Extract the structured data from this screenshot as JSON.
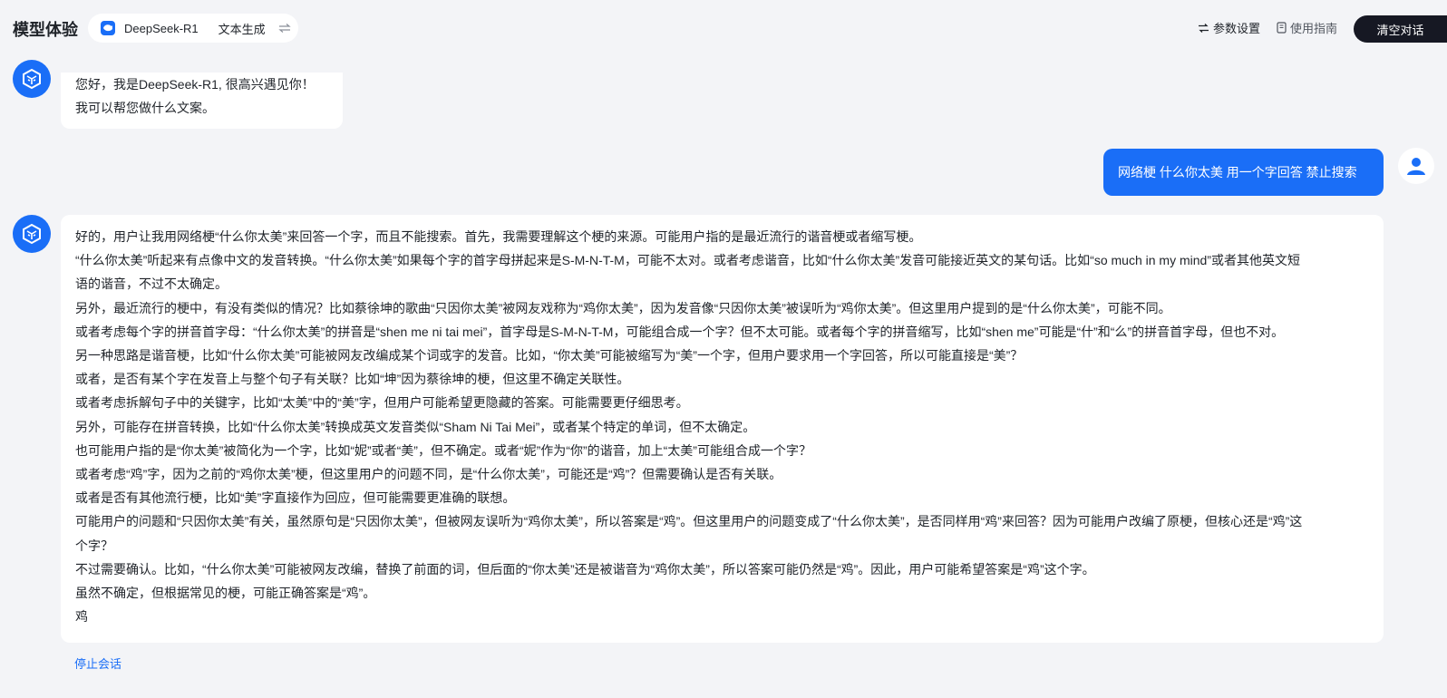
{
  "header": {
    "app_title": "模型体验",
    "model_name": "DeepSeek-R1",
    "model_mode": "文本生成",
    "params_label": "参数设置",
    "guide_label": "使用指南",
    "clear_label": "清空对话"
  },
  "icons": {
    "model_logo": "whale-logo-icon",
    "swap": "swap-arrows-icon",
    "params": "sliders-swap-icon",
    "guide": "document-icon",
    "bot_avatar": "cube-logo-icon",
    "user_avatar": "person-icon"
  },
  "colors": {
    "accent": "#1a6ef7",
    "clear_button": "#161823",
    "background": "#f3f4f7"
  },
  "chat": {
    "greeting_lines": [
      "您好，我是DeepSeek-R1, 很高兴遇见你！",
      "我可以帮您做什么文案。"
    ],
    "user_message": "网络梗 什么你太美 用一个字回答 禁止搜索",
    "answer_lines": [
      "好的，用户让我用网络梗“什么你太美”来回答一个字，而且不能搜索。首先，我需要理解这个梗的来源。可能用户指的是最近流行的谐音梗或者缩写梗。",
      "“什么你太美”听起来有点像中文的发音转换。“什么你太美”如果每个字的首字母拼起来是S-M-N-T-M，可能不太对。或者考虑谐音，比如“什么你太美”发音可能接近英文的某句话。比如“so much in my mind”或者其他英文短",
      "语的谐音，不过不太确定。",
      "另外，最近流行的梗中，有没有类似的情况？比如蔡徐坤的歌曲“只因你太美”被网友戏称为“鸡你太美”，因为发音像“只因你太美”被误听为“鸡你太美”。但这里用户提到的是“什么你太美”，可能不同。",
      "或者考虑每个字的拼音首字母：“什么你太美”的拼音是“shen me ni tai mei”，首字母是S-M-N-T-M，可能组合成一个字？但不太可能。或者每个字的拼音缩写，比如“shen me”可能是“什”和“么”的拼音首字母，但也不对。",
      "另一种思路是谐音梗，比如“什么你太美”可能被网友改编成某个词或字的发音。比如，“你太美”可能被缩写为“美”一个字，但用户要求用一个字回答，所以可能直接是“美”？",
      "或者，是否有某个字在发音上与整个句子有关联？比如“坤”因为蔡徐坤的梗，但这里不确定关联性。",
      "或者考虑拆解句子中的关键字，比如“太美”中的“美”字，但用户可能希望更隐藏的答案。可能需要更仔细思考。",
      "另外，可能存在拼音转换，比如“什么你太美”转换成英文发音类似“Sham Ni Tai Mei”，或者某个特定的单词，但不太确定。",
      "也可能用户指的是“你太美”被简化为一个字，比如“妮”或者“美”，但不确定。或者“妮”作为“你”的谐音，加上“太美”可能组合成一个字？",
      "或者考虑“鸡”字，因为之前的“鸡你太美”梗，但这里用户的问题不同，是“什么你太美”，可能还是“鸡”？但需要确认是否有关联。",
      "或者是否有其他流行梗，比如“美”字直接作为回应，但可能需要更准确的联想。",
      "可能用户的问题和“只因你太美”有关，虽然原句是“只因你太美”，但被网友误听为“鸡你太美”，所以答案是“鸡”。但这里用户的问题变成了“什么你太美”，是否同样用“鸡”来回答？因为可能用户改编了原梗，但核心还是“鸡”这",
      "个字？",
      "不过需要确认。比如，“什么你太美”可能被网友改编，替换了前面的词，但后面的“你太美”还是被谐音为“鸡你太美”，所以答案可能仍然是“鸡”。因此，用户可能希望答案是“鸡”这个字。",
      "虽然不确定，但根据常见的梗，可能正确答案是“鸡”。",
      "鸡"
    ],
    "stop_label": "停止会话"
  }
}
